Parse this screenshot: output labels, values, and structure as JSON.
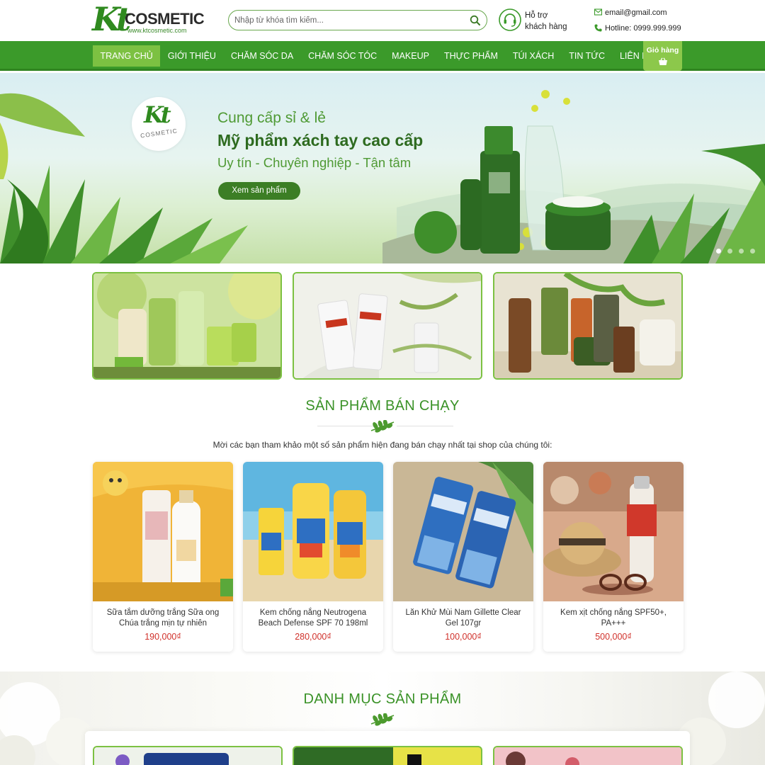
{
  "header": {
    "logo_brand": "COSMETIC",
    "logo_mark": "Kt",
    "logo_site": "www.ktcosmetic.com",
    "search_placeholder": "Nhập từ khóa tìm kiếm...",
    "support_line1": "Hỗ trợ",
    "support_line2": "khách hàng",
    "email": "email@gmail.com",
    "hotline": "Hotline: 0999.999.999"
  },
  "nav": {
    "items": [
      "Trang chủ",
      "Giới thiệu",
      "Chăm sóc da",
      "Chăm sóc tóc",
      "Makeup",
      "Thực phẩm",
      "Túi xách",
      "Tin tức",
      "Liên hệ"
    ],
    "active": "Trang chủ",
    "cart_label": "Giỏ hàng"
  },
  "banner": {
    "logo_mark": "Kt",
    "logo_word": "COSMETIC",
    "line1": "Cung cấp sỉ & lẻ",
    "line2": "Mỹ phẩm xách tay cao cấp",
    "line3": "Uy tín - Chuyên nghiệp - Tận tâm",
    "button": "Xem sản phẩm",
    "slides": 4,
    "active_slide": 1
  },
  "bestsellers": {
    "title": "Sản phẩm bán chạy",
    "description": "Mời các bạn tham khảo một số sản phẩm hiện đang bán chạy nhất tại shop của chúng tôi:",
    "products": [
      {
        "name": "Sữa tắm dưỡng trắng Sữa ong Chúa trắng mịn tự nhiên",
        "price": "190,000₫"
      },
      {
        "name": "Kem chống nắng Neutrogena Beach Defense SPF 70 198ml",
        "price": "280,000₫"
      },
      {
        "name": "Lăn Khử Mùi Nam Gillette Clear Gel 107gr",
        "price": "100,000₫"
      },
      {
        "name": "Kem xịt chống nắng SPF50+, PA+++",
        "price": "500,000₫"
      }
    ]
  },
  "categories": {
    "title": "Danh mục sản phẩm"
  },
  "colors": {
    "primary_green": "#3b9a2a",
    "active_nav": "#7cc142",
    "price_red": "#d0302a"
  }
}
